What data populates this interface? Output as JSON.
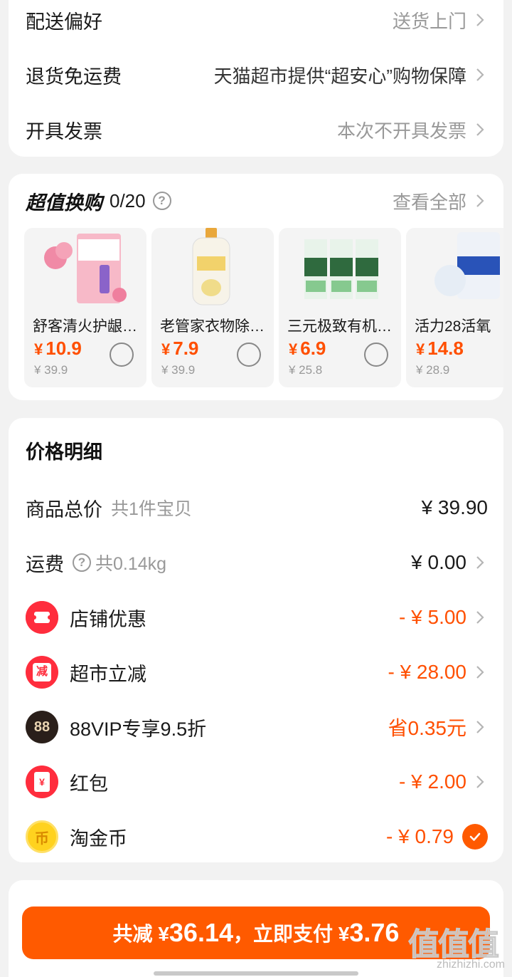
{
  "settings": {
    "rows": [
      {
        "label": "配送偏好",
        "value": "送货上门"
      },
      {
        "label": "退货免运费",
        "value": "天猫超市提供“超安心”购物保障"
      },
      {
        "label": "开具发票",
        "value": "本次不开具发票"
      }
    ]
  },
  "swap": {
    "title": "超值换购",
    "count": "0/20",
    "help": "?",
    "view_all": "查看全部",
    "products": [
      {
        "name": "舒客清火护龈牙膏",
        "currency": "¥",
        "price": "10.9",
        "original": "¥ 39.9"
      },
      {
        "name": "老管家衣物除菌液",
        "currency": "¥",
        "price": "7.9",
        "original": "¥ 39.9"
      },
      {
        "name": "三元极致有机纯牛奶",
        "currency": "¥",
        "price": "6.9",
        "original": "¥ 25.8"
      },
      {
        "name": "活力28活氧",
        "currency": "¥",
        "price": "14.8",
        "original": "¥ 28.9"
      }
    ]
  },
  "price": {
    "title": "价格明细",
    "goods_label": "商品总价",
    "goods_sub": "共1件宝贝",
    "goods_value": "¥ 39.90",
    "shipping_label": "运费",
    "shipping_sub": "共0.14kg",
    "shipping_value": "¥ 0.00",
    "shop_label": "店铺优惠",
    "shop_value": "- ¥ 5.00",
    "market_label": "超市立减",
    "market_icon_text": "减",
    "market_value": "- ¥ 28.00",
    "vip_label": "88VIP专享9.5折",
    "vip_icon_text": "88",
    "vip_value": "省0.35元",
    "redpacket_label": "红包",
    "redpacket_icon_text": "¥",
    "redpacket_value": "- ¥ 2.00",
    "coin_label": "淘金币",
    "coin_icon_text": "币",
    "coin_value": "- ¥ 0.79"
  },
  "pay": {
    "prefix": "共减 ¥",
    "saved": "36.14",
    "middle": "，立即支付 ¥",
    "amount": "3.76"
  },
  "watermark": {
    "chars": "值值值",
    "url": "zhizhizhi.com"
  },
  "colors": {
    "accent": "#ff5a00",
    "price_red": "#ff4f00",
    "muted": "#999999"
  }
}
